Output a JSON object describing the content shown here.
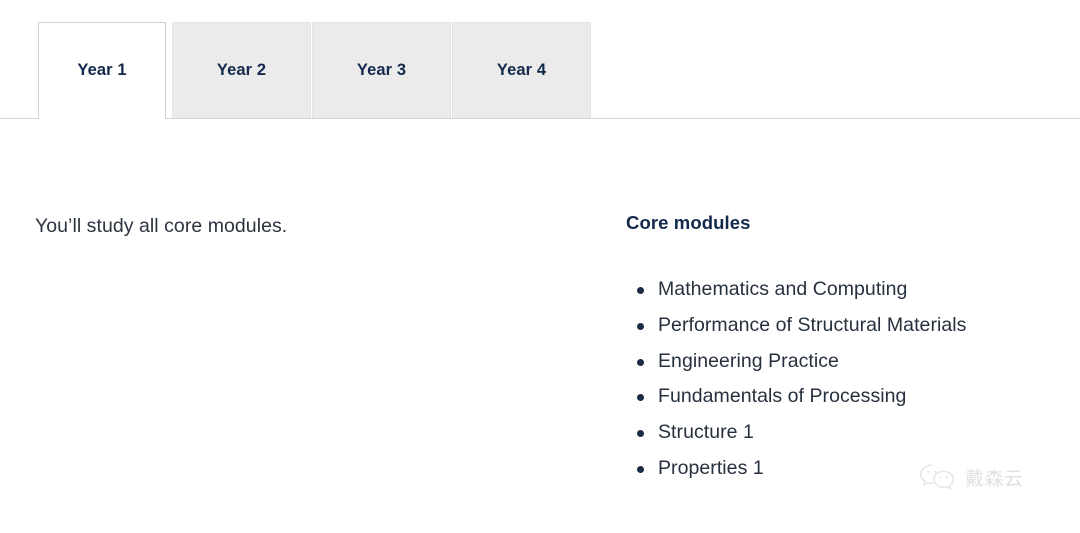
{
  "tabs": {
    "active_index": 0,
    "items": [
      {
        "label": "Year 1",
        "state": "active"
      },
      {
        "label": "Year 2",
        "state": "inactive"
      },
      {
        "label": "Year 3",
        "state": "inactive"
      },
      {
        "label": "Year 4",
        "state": "inactive"
      }
    ]
  },
  "panel": {
    "intro_text": "You’ll study all core modules.",
    "modules_heading": "Core modules",
    "modules": [
      "Mathematics and Computing",
      "Performance of Structural Materials",
      "Engineering Practice",
      "Fundamentals of Processing",
      "Structure 1",
      "Properties 1"
    ]
  },
  "watermark": {
    "icon": "wechat-icon",
    "label": "戴森云"
  },
  "colors": {
    "tab_text": "#13294b",
    "tab_inactive_bg": "#ebebeb",
    "tab_active_bg": "#ffffff",
    "tab_border": "#cfd0d2",
    "underline": "#d3d4d6",
    "heading": "#13294b",
    "body_text": "#26303e",
    "bullet": "#1c2b45",
    "page_bg": "#ffffff"
  }
}
